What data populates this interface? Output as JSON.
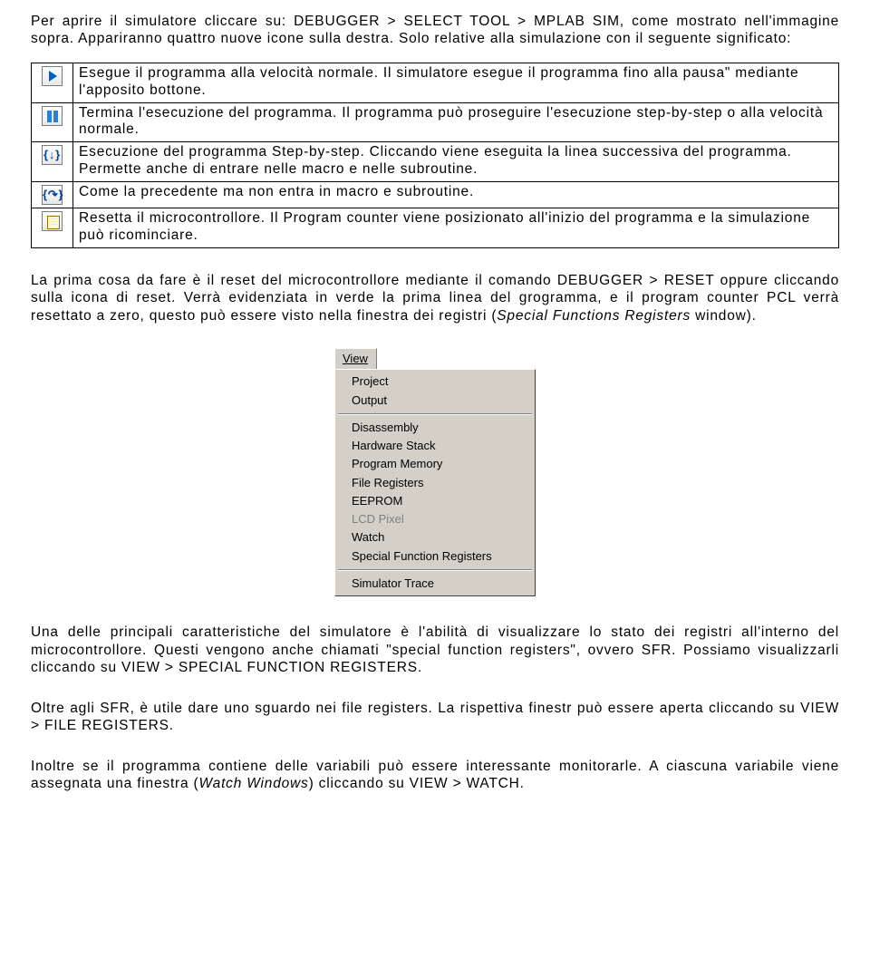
{
  "intro": {
    "p1": "Per aprire il simulatore cliccare su: DEBUGGER > SELECT TOOL > MPLAB SIM, come mostrato nell'immagine sopra. Appariranno quattro nuove icone sulla destra. Solo relative alla simulazione con il seguente significato:"
  },
  "icons": [
    {
      "name": "run-icon",
      "text": "Esegue il programma alla velocità normale. Il simulatore esegue il programma fino alla pausa\" mediante l'apposito bottone."
    },
    {
      "name": "pause-icon",
      "text": "Termina l'esecuzione del programma. Il programma può proseguire l'esecuzione step-by-step o alla velocità normale."
    },
    {
      "name": "step-into-icon",
      "text": "Esecuzione del programma Step-by-step. Cliccando viene eseguita la linea successiva del programma. Permette anche di entrare nelle macro e nelle subroutine."
    },
    {
      "name": "step-over-icon",
      "text": "Come la precedente ma non entra in macro e subroutine."
    },
    {
      "name": "reset-icon",
      "text": "Resetta il microcontrollore. Il Program counter viene posizionato all'inizio del programma e la simulazione può ricominciare."
    }
  ],
  "after_table": {
    "p1": "La prima cosa da fare è il reset del microcontrollore mediante il comando DEBUGGER > RESET oppure cliccando sulla icona di reset. Verrà evidenziata in verde la prima linea del grogramma, e il program counter PCL verrà resettato a zero, questo può essere visto nella finestra dei registri (",
    "p1_italic": "Special Functions Registers",
    "p1_tail": " window)."
  },
  "menu": {
    "tab": "View",
    "groups": [
      [
        "Project",
        "Output"
      ],
      [
        "Disassembly",
        "Hardware Stack",
        "Program Memory",
        "File Registers",
        "EEPROM",
        {
          "label": "LCD Pixel",
          "disabled": true
        },
        "Watch",
        "Special Function Registers"
      ],
      [
        "Simulator Trace"
      ]
    ]
  },
  "bottom": {
    "p1": "Una delle principali caratteristiche del simulatore è l'abilità di visualizzare lo stato dei registri all'interno del microcontrollore. Questi vengono anche chiamati \"special function registers\", ovvero SFR. Possiamo visualizzarli cliccando su VIEW > SPECIAL FUNCTION REGISTERS.",
    "p2": "Oltre agli SFR, è utile dare uno sguardo nei file registers. La rispettiva finestr può essere aperta cliccando su VIEW > FILE REGISTERS.",
    "p3_a": "Inoltre se il programma contiene delle variabili può essere interessante monitorarle. A ciascuna variabile viene assegnata una finestra (",
    "p3_i": "Watch Windows",
    "p3_b": ") cliccando su VIEW > WATCH."
  }
}
